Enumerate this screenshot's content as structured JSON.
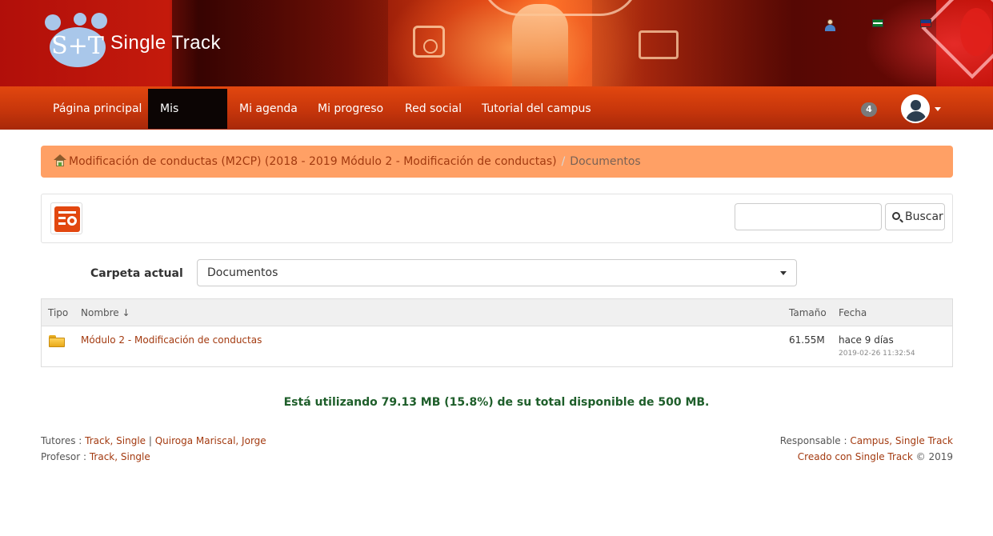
{
  "header": {
    "logo_text": "S+T",
    "brand_name": "Single Track"
  },
  "nav": {
    "items": [
      {
        "label": "Página principal"
      },
      {
        "label": "Mis cursos"
      },
      {
        "label": "Mi agenda"
      },
      {
        "label": "Mi progreso"
      },
      {
        "label": "Red social"
      },
      {
        "label": "Tutorial del campus"
      }
    ],
    "active": "Mis cursos",
    "notification_count": "4"
  },
  "breadcrumb": {
    "course": "Modificación de conductas (M2CP) (2018 - 2019 Módulo 2 - Modificación de conductas)",
    "separator": "/",
    "current": "Documentos"
  },
  "toolbar": {
    "search_placeholder": "",
    "search_button": "Buscar"
  },
  "folder": {
    "label": "Carpeta actual",
    "selected": "Documentos"
  },
  "table": {
    "columns": [
      "Tipo",
      "Nombre ↓",
      "Tamaño",
      "Fecha"
    ],
    "rows": [
      {
        "type_icon": "folder-icon",
        "name": "Módulo 2 - Modificación de conductas",
        "size": "61.55M",
        "date_relative": "hace 9 días",
        "date_exact": "2019-02-26 11:32:54"
      }
    ]
  },
  "quota_text": "Está utilizando 79.13 MB (15.8%) de su total disponible de 500 MB.",
  "footer": {
    "tutores_label": "Tutores : ",
    "tutor1": "Track, Single",
    "tutor_sep": " | ",
    "tutor2": "Quiroga Mariscal, Jorge",
    "profesor_label": "Profesor : ",
    "profesor": "Track, Single",
    "responsable_label": "Responsable : ",
    "responsable": "Campus, Single Track",
    "created": "Creado con Single Track",
    "copyright": " © 2019"
  },
  "colors": {
    "navbar": "#c7360b",
    "active_nav": "#0c0504",
    "breadcrumb_bg": "#ffa065",
    "link": "#a33a10",
    "quota_text": "#1e5e2a"
  }
}
